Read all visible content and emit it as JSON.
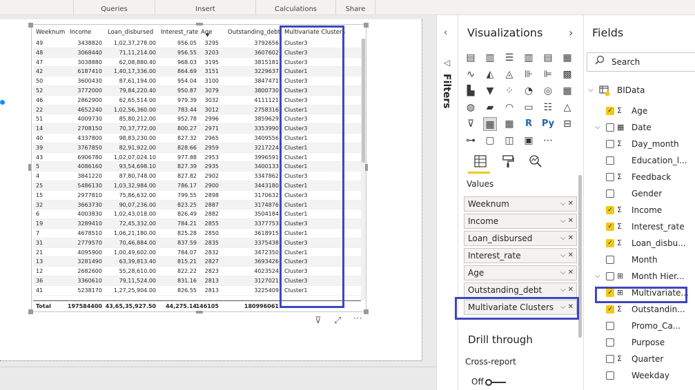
{
  "ribbon": {
    "groups": [
      "Queries",
      "Insert",
      "Calculations",
      "Share"
    ]
  },
  "colors": {
    "accent_yellow": "#f2c811",
    "highlight_blue": "#3d45c0",
    "selection_dot": "#118dff"
  },
  "table": {
    "columns": [
      "Weeknum",
      "Income",
      "Loan_disbursed",
      "Interest_rate",
      "Age",
      "Outstanding_debt",
      "Multivariate Clusters"
    ],
    "rows": [
      [
        "49",
        "3438820",
        "1,02,37,278.00",
        "956.05",
        "3295",
        "3792656",
        "Cluster3"
      ],
      [
        "48",
        "3068440",
        "71,11,214.00",
        "956.55",
        "3203",
        "3607602",
        "Cluster3"
      ],
      [
        "47",
        "3038880",
        "62,08,880.40",
        "968.03",
        "3195",
        "3815181",
        "Cluster3"
      ],
      [
        "42",
        "6187410",
        "1,40,17,336.00",
        "864.69",
        "3151",
        "3229637",
        "Cluster1"
      ],
      [
        "50",
        "3600430",
        "87,61,194.00",
        "954.04",
        "3100",
        "3847471",
        "Cluster3"
      ],
      [
        "52",
        "3772000",
        "79,84,220.40",
        "950.87",
        "3079",
        "3800730",
        "Cluster3"
      ],
      [
        "46",
        "2862900",
        "62,65,514.00",
        "979.39",
        "3032",
        "4111121",
        "Cluster3"
      ],
      [
        "22",
        "4652240",
        "1,02,56,360.00",
        "783.44",
        "3012",
        "2758316",
        "Cluster1"
      ],
      [
        "51",
        "4009730",
        "85,80,212.00",
        "952.78",
        "2996",
        "3859629",
        "Cluster3"
      ],
      [
        "14",
        "2708150",
        "70,37,772.00",
        "800.27",
        "2971",
        "3353990",
        "Cluster3"
      ],
      [
        "40",
        "4337800",
        "98,83,230.00",
        "827.32",
        "2965",
        "3409556",
        "Cluster1"
      ],
      [
        "39",
        "3767850",
        "82,91,922.00",
        "828.66",
        "2959",
        "3217224",
        "Cluster1"
      ],
      [
        "43",
        "6906780",
        "1,02,07,024.10",
        "977.88",
        "2953",
        "3996591",
        "Cluster1"
      ],
      [
        "5",
        "4086160",
        "93,54,698.10",
        "827.39",
        "2935",
        "3400133",
        "Cluster1"
      ],
      [
        "4",
        "3841220",
        "87,80,748.00",
        "827.82",
        "2902",
        "3347862",
        "Cluster3"
      ],
      [
        "25",
        "5486130",
        "1,03,32,984.00",
        "786.17",
        "2900",
        "3443180",
        "Cluster1"
      ],
      [
        "15",
        "2977810",
        "75,86,632.00",
        "799.55",
        "2898",
        "3170632",
        "Cluster3"
      ],
      [
        "32",
        "3663730",
        "90,07,236.00",
        "823.25",
        "2887",
        "3174876",
        "Cluster1"
      ],
      [
        "6",
        "4003830",
        "1,02,43,018.00",
        "826.49",
        "2882",
        "3504184",
        "Cluster1"
      ],
      [
        "19",
        "3289410",
        "72,45,332.00",
        "784.21",
        "2855",
        "3377753",
        "Cluster3"
      ],
      [
        "7",
        "4678510",
        "1,06,21,180.00",
        "825.28",
        "2850",
        "3618915",
        "Cluster1"
      ],
      [
        "31",
        "2779570",
        "70,46,884.00",
        "837.59",
        "2835",
        "3375438",
        "Cluster3"
      ],
      [
        "21",
        "4095900",
        "1,00,49,602.00",
        "784.07",
        "2832",
        "3472350",
        "Cluster1"
      ],
      [
        "13",
        "3281490",
        "63,39,813.40",
        "815.21",
        "2827",
        "3693426",
        "Cluster3"
      ],
      [
        "12",
        "2682600",
        "55,28,610.00",
        "822.22",
        "2823",
        "4023524",
        "Cluster3"
      ],
      [
        "36",
        "3360610",
        "79,11,524.00",
        "831.16",
        "2813",
        "3127021",
        "Cluster3"
      ],
      [
        "41",
        "5238170",
        "1,27,25,904.00",
        "826.55",
        "2813",
        "3225409",
        "Cluster1"
      ]
    ],
    "total": [
      "Total",
      "197584400",
      "43,65,35,927.50",
      "44,275.14",
      "146105",
      "180996061",
      ""
    ],
    "sort_caret": "▼"
  },
  "visual_icons": {
    "filter": "⊽",
    "focus": "⤢",
    "more": "⋯"
  },
  "filters": {
    "label": "Filters",
    "collapse_icon": "◁"
  },
  "visualizations": {
    "title": "Visualizations",
    "back": "‹",
    "forward": "›",
    "tabs": [
      "fields-tab",
      "format-tab",
      "analytics-tab"
    ],
    "values_label": "Values",
    "wells": [
      "Weeknum",
      "Income",
      "Loan_disbursed",
      "Interest_rate",
      "Age",
      "Outstanding_debt",
      "Multivariate Clusters"
    ],
    "well_controls": "⌵ ✕",
    "drill_title": "Drill through",
    "cross_report": "Cross-report",
    "off_label": "Off"
  },
  "fields": {
    "title": "Fields",
    "search_placeholder": "Search",
    "table_name": "BIData",
    "items": [
      {
        "name": "Age",
        "checked": true,
        "type": "Σ",
        "expand": ""
      },
      {
        "name": "Date",
        "checked": false,
        "type": "▦",
        "expand": "⌵"
      },
      {
        "name": "Day_month",
        "checked": false,
        "type": "Σ",
        "expand": ""
      },
      {
        "name": "Education_l...",
        "checked": false,
        "type": "",
        "expand": ""
      },
      {
        "name": "Feedback",
        "checked": false,
        "type": "Σ",
        "expand": ""
      },
      {
        "name": "Gender",
        "checked": false,
        "type": "",
        "expand": ""
      },
      {
        "name": "Income",
        "checked": true,
        "type": "Σ",
        "expand": ""
      },
      {
        "name": "Interest_rate",
        "checked": true,
        "type": "Σ",
        "expand": ""
      },
      {
        "name": "Loan_disbu...",
        "checked": true,
        "type": "Σ",
        "expand": ""
      },
      {
        "name": "Month",
        "checked": false,
        "type": "",
        "expand": ""
      },
      {
        "name": "Month Hier...",
        "checked": false,
        "type": "⊞",
        "expand": "⌵"
      },
      {
        "name": "Multivariate...",
        "checked": true,
        "type": "⊞",
        "expand": ""
      },
      {
        "name": "Outstandin...",
        "checked": true,
        "type": "Σ",
        "expand": ""
      },
      {
        "name": "Promo_Ca...",
        "checked": false,
        "type": "",
        "expand": ""
      },
      {
        "name": "Purpose",
        "checked": false,
        "type": "",
        "expand": ""
      },
      {
        "name": "Quarter",
        "checked": false,
        "type": "Σ",
        "expand": ""
      },
      {
        "name": "Weekday",
        "checked": false,
        "type": "",
        "expand": ""
      }
    ]
  }
}
